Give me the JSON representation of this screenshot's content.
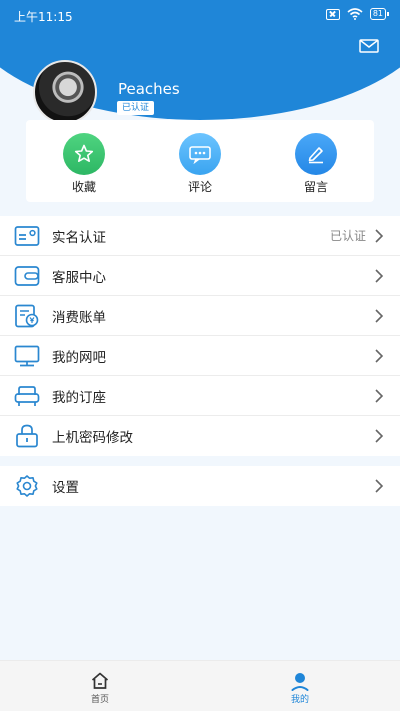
{
  "status_bar": {
    "time": "上午11:15",
    "battery": "81"
  },
  "profile": {
    "username": "Peaches",
    "badge": "已认证"
  },
  "actions": [
    {
      "label": "收藏",
      "icon": "star-icon"
    },
    {
      "label": "评论",
      "icon": "comment-icon"
    },
    {
      "label": "留言",
      "icon": "pen-icon"
    }
  ],
  "menu": [
    {
      "label": "实名认证",
      "status": "已认证",
      "icon": "id-card-icon"
    },
    {
      "label": "客服中心",
      "icon": "wallet-icon"
    },
    {
      "label": "消费账单",
      "icon": "bill-icon"
    },
    {
      "label": "我的网吧",
      "icon": "monitor-icon"
    },
    {
      "label": "我的订座",
      "icon": "seat-icon"
    },
    {
      "label": "上机密码修改",
      "icon": "lock-icon"
    }
  ],
  "settings": {
    "label": "设置",
    "icon": "gear-icon"
  },
  "tabbar": [
    {
      "label": "首页",
      "icon": "home-icon"
    },
    {
      "label": "我的",
      "icon": "user-icon"
    }
  ],
  "colors": {
    "primary": "#1f86d8",
    "icon_blue": "#2a87d0",
    "green": "#2db764"
  }
}
